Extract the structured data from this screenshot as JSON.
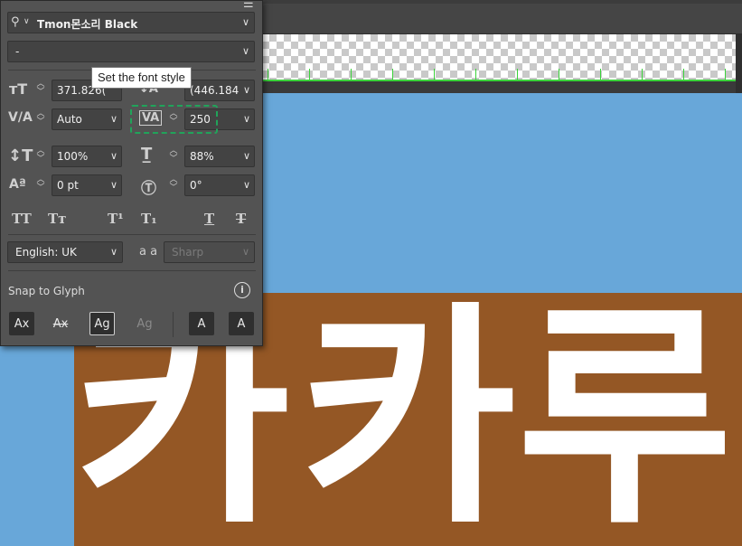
{
  "panel": {
    "font_family": "Tmon몬소리 Black",
    "font_style": "-",
    "tooltip": "Set the font style",
    "font_size": "371.826(",
    "leading": "(446.184",
    "kerning": "Auto",
    "tracking": "250",
    "vertical_scale": "100%",
    "horizontal_scale": "88%",
    "baseline_shift": "0 pt",
    "rotation": "0°",
    "language": "English: UK",
    "anti_alias_icon_label": "a a",
    "anti_alias": "Sharp",
    "snap_to_glyph_label": "Snap to Glyph",
    "format_buttons": [
      "TT",
      "Tт",
      "T¹",
      "T₁",
      "T",
      "T"
    ],
    "snap_buttons": [
      "Ax",
      "Ax",
      "Ag",
      "Ag",
      "A",
      "A"
    ]
  },
  "canvas": {
    "glyphs": [
      "카",
      "카",
      "루"
    ],
    "colors": {
      "sky": "#68a7d9",
      "artboard": "#945725",
      "text": "#ffffff",
      "guide": "#3bd23b"
    }
  }
}
